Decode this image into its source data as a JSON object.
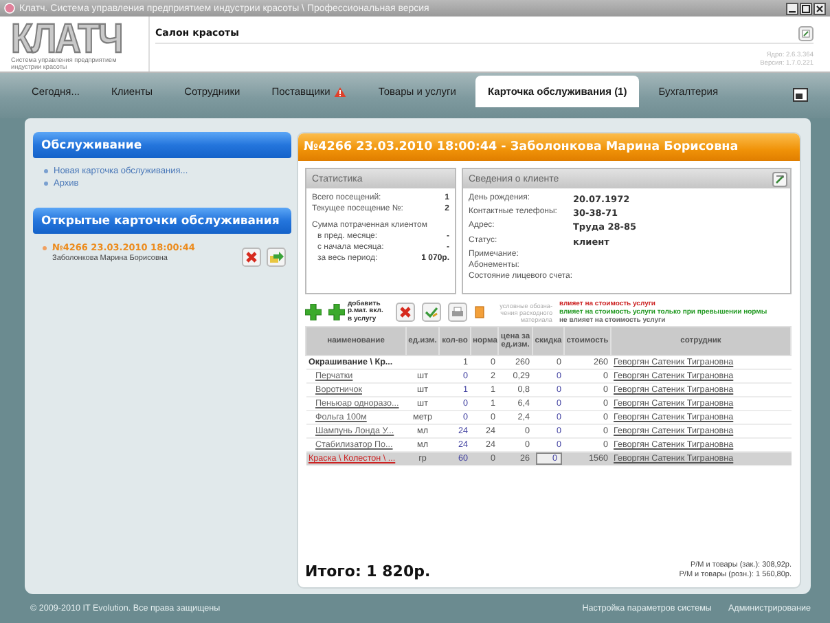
{
  "window": {
    "title": "Клатч. Система управления предприятием индустрии красоты \\ Профессиональная версия"
  },
  "header": {
    "logo": "КЛАТЧ",
    "tagline": "Система управления предприятием индустрии красоты",
    "salon": "Салон красоты",
    "core_version": "Ядро: 2.6.3.364",
    "version": "Версия: 1.7.0.221"
  },
  "tabs": [
    {
      "label": "Сегодня...",
      "selected": false,
      "alert": false
    },
    {
      "label": "Клиенты",
      "selected": false,
      "alert": false
    },
    {
      "label": "Сотрудники",
      "selected": false,
      "alert": false
    },
    {
      "label": "Поставщики",
      "selected": false,
      "alert": true
    },
    {
      "label": "Товары и услуги",
      "selected": false,
      "alert": false
    },
    {
      "label": "Карточка обслуживания (1)",
      "selected": true,
      "alert": false
    },
    {
      "label": "Бухгалтерия",
      "selected": false,
      "alert": false
    }
  ],
  "sidebar": {
    "service": {
      "title": "Обслуживание",
      "links": [
        "Новая карточка обслуживания...",
        "Архив"
      ]
    },
    "open_cards": {
      "title": "Открытые карточки обслуживания",
      "items": [
        {
          "title": "№4266 23.03.2010 18:00:44",
          "client": "Заболонкова Марина Борисовна"
        }
      ]
    }
  },
  "card": {
    "title": "№4266 23.03.2010 18:00:44 - Заболонкова Марина Борисовна",
    "statistics": {
      "title": "Статистика",
      "rows": [
        {
          "kind": "count",
          "label": "Всего посещений:",
          "value": "1"
        },
        {
          "kind": "count",
          "label": "Текущее посещение №:",
          "value": "2"
        },
        {
          "kind": "heading",
          "label": "Сумма потраченная клиентом"
        },
        {
          "kind": "sum",
          "label": "в пред. месяце:",
          "value": "-"
        },
        {
          "kind": "sum",
          "label": "с начала месяца:",
          "value": "-"
        },
        {
          "kind": "sum",
          "label": "за весь период:",
          "value": "1 070р."
        }
      ]
    },
    "client_info": {
      "title": "Сведения о клиенте",
      "rows": [
        {
          "label": "День рождения:",
          "value": "20.07.1972"
        },
        {
          "label": "Контактные телефоны:",
          "value": "30-38-71"
        },
        {
          "label": "Адрес:",
          "value": "Труда 28-85"
        },
        {
          "label": "Статус:",
          "value": "клиент"
        },
        {
          "label": "Примечание:"
        },
        {
          "label": "Абонементы:"
        },
        {
          "label": "Состояние лицевого счета:"
        }
      ]
    },
    "add_material_label": "добавить р.мат. вкл. в услугу",
    "legend_hint": "условные обозна- чения расходного материала",
    "legend": [
      {
        "text": "влияет на стоимость услуги",
        "color": "#cc2222"
      },
      {
        "text": "влияет на стоимость услуги только при превышении нормы",
        "color": "#229922"
      },
      {
        "text": "не влияет на стоимость услуги",
        "color": "#666666"
      }
    ],
    "table": {
      "columns": [
        "наименование",
        "ед.изм.",
        "кол-во",
        "норма",
        "цена за ед.изм.",
        "скидка",
        "стоимость",
        "сотрудник"
      ],
      "rows": [
        {
          "kind": "service",
          "selected": false,
          "cells": [
            "Окрашивание \\ Кр...",
            "",
            "1",
            "0",
            "260",
            "0",
            "260",
            "Геворгян Сатеник Тиграновна"
          ]
        },
        {
          "kind": "material",
          "selected": false,
          "color": "#666666",
          "cells": [
            "Перчатки",
            "шт",
            "0",
            "2",
            "0,29",
            "0",
            "0",
            "Геворгян Сатеник Тиграновна"
          ]
        },
        {
          "kind": "material",
          "selected": false,
          "color": "#666666",
          "cells": [
            "Воротничок",
            "шт",
            "1",
            "1",
            "0,8",
            "0",
            "0",
            "Геворгян Сатеник Тиграновна"
          ]
        },
        {
          "kind": "material",
          "selected": false,
          "color": "#666666",
          "cells": [
            "Пеньюар одноразо...",
            "шт",
            "0",
            "1",
            "6,4",
            "0",
            "0",
            "Геворгян Сатеник Тиграновна"
          ]
        },
        {
          "kind": "material",
          "selected": false,
          "color": "#666666",
          "cells": [
            "Фольга 100м",
            "метр",
            "0",
            "0",
            "2,4",
            "0",
            "0",
            "Геворгян Сатеник Тиграновна"
          ]
        },
        {
          "kind": "material",
          "selected": false,
          "color": "#666666",
          "cells": [
            "Шампунь Лонда У...",
            "мл",
            "24",
            "24",
            "0",
            "0",
            "0",
            "Геворгян Сатеник Тиграновна"
          ]
        },
        {
          "kind": "material",
          "selected": false,
          "color": "#666666",
          "cells": [
            "Стабилизатор По...",
            "мл",
            "24",
            "24",
            "0",
            "0",
            "0",
            "Геворгян Сатеник Тиграновна"
          ]
        },
        {
          "kind": "top",
          "selected": true,
          "color": "#cc2222",
          "cells": [
            "Краска \\ Колестон \\ ...",
            "гр",
            "60",
            "0",
            "26",
            "0",
            "1560",
            "Геворгян Сатеник Тиграновна"
          ]
        }
      ]
    },
    "total": "Итого: 1 820р.",
    "wholesale": "Р/М и товары (зак.): 308,92р.",
    "retail": "Р/М и товары (розн.): 1 560,80р."
  },
  "footer": {
    "copyright": "© 2009-2010 IT Evolution. Все права защищены",
    "links": [
      "Настройка параметров системы",
      "Администрирование"
    ]
  }
}
